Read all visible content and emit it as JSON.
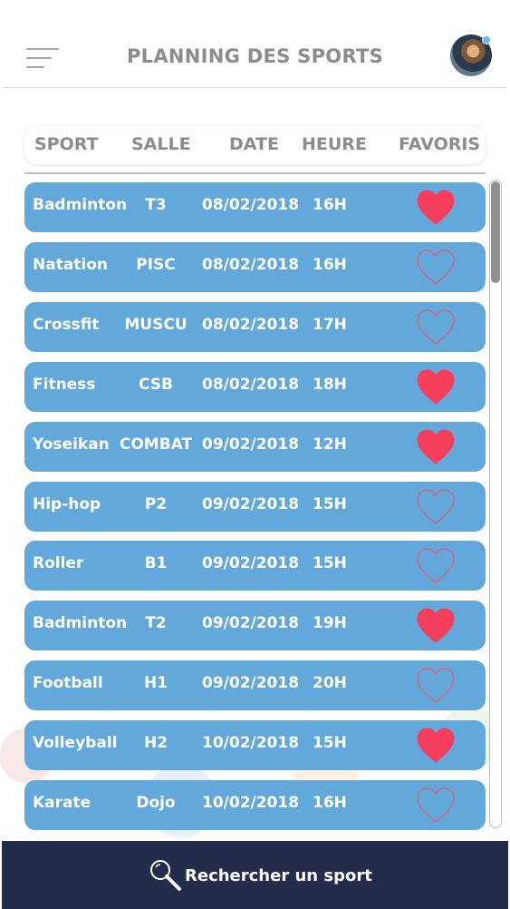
{
  "header": {
    "title": "PLANNING DES SPORTS",
    "menu_icon": "hamburger-menu-icon",
    "avatar": "user-avatar"
  },
  "columns": {
    "sport": "SPORT",
    "salle": "SALLE",
    "date": "DATE",
    "heure": "HEURE",
    "favoris": "FAVORIS"
  },
  "rows": [
    {
      "sport": "Badminton",
      "salle": "T3",
      "date": "08/02/2018",
      "heure": "16H",
      "favorite": true
    },
    {
      "sport": "Natation",
      "salle": "PISC",
      "date": "08/02/2018",
      "heure": "16H",
      "favorite": false
    },
    {
      "sport": "Crossfit",
      "salle": "MUSCU",
      "date": "08/02/2018",
      "heure": "17H",
      "favorite": false
    },
    {
      "sport": "Fitness",
      "salle": "CSB",
      "date": "08/02/2018",
      "heure": "18H",
      "favorite": true
    },
    {
      "sport": "Yoseikan",
      "salle": "COMBAT",
      "date": "09/02/2018",
      "heure": "12H",
      "favorite": true
    },
    {
      "sport": "Hip-hop",
      "salle": "P2",
      "date": "09/02/2018",
      "heure": "15H",
      "favorite": false
    },
    {
      "sport": "Roller",
      "salle": "B1",
      "date": "09/02/2018",
      "heure": "15H",
      "favorite": false
    },
    {
      "sport": "Badminton",
      "salle": "T2",
      "date": "09/02/2018",
      "heure": "19H",
      "favorite": true
    },
    {
      "sport": "Football",
      "salle": "H1",
      "date": "09/02/2018",
      "heure": "20H",
      "favorite": false
    },
    {
      "sport": "Volleyball",
      "salle": "H2",
      "date": "10/02/2018",
      "heure": "15H",
      "favorite": true
    },
    {
      "sport": "Karate",
      "salle": "Dojo",
      "date": "10/02/2018",
      "heure": "16H",
      "favorite": false
    }
  ],
  "search": {
    "label": "Rechercher un sport",
    "icon": "search-icon"
  },
  "colors": {
    "row_bg": "#62a8db",
    "heart_filled": "#f53d5c",
    "heart_outline": "#e85a6e",
    "bottom_bar": "#232d4b",
    "header_text": "#8c8c8c"
  }
}
